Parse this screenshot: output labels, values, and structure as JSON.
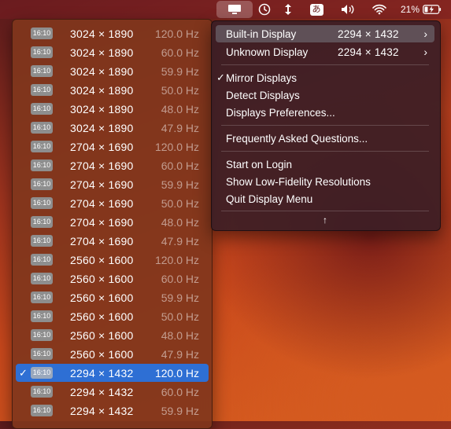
{
  "menubar": {
    "battery_percent": "21%",
    "input_source": "あ",
    "icons": [
      "display-menu-icon",
      "screen-time-icon",
      "resize-arrows-icon",
      "input-source-icon",
      "volume-icon",
      "wifi-icon",
      "battery-charging-icon"
    ]
  },
  "resolutions": [
    {
      "aspect": "16:10",
      "resolution": "3024 × 1890",
      "refresh": "120.0 Hz",
      "selected": false
    },
    {
      "aspect": "16:10",
      "resolution": "3024 × 1890",
      "refresh": "60.0 Hz",
      "selected": false
    },
    {
      "aspect": "16:10",
      "resolution": "3024 × 1890",
      "refresh": "59.9 Hz",
      "selected": false
    },
    {
      "aspect": "16:10",
      "resolution": "3024 × 1890",
      "refresh": "50.0 Hz",
      "selected": false
    },
    {
      "aspect": "16:10",
      "resolution": "3024 × 1890",
      "refresh": "48.0 Hz",
      "selected": false
    },
    {
      "aspect": "16:10",
      "resolution": "3024 × 1890",
      "refresh": "47.9 Hz",
      "selected": false
    },
    {
      "aspect": "16:10",
      "resolution": "2704 × 1690",
      "refresh": "120.0 Hz",
      "selected": false
    },
    {
      "aspect": "16:10",
      "resolution": "2704 × 1690",
      "refresh": "60.0 Hz",
      "selected": false
    },
    {
      "aspect": "16:10",
      "resolution": "2704 × 1690",
      "refresh": "59.9 Hz",
      "selected": false
    },
    {
      "aspect": "16:10",
      "resolution": "2704 × 1690",
      "refresh": "50.0 Hz",
      "selected": false
    },
    {
      "aspect": "16:10",
      "resolution": "2704 × 1690",
      "refresh": "48.0 Hz",
      "selected": false
    },
    {
      "aspect": "16:10",
      "resolution": "2704 × 1690",
      "refresh": "47.9 Hz",
      "selected": false
    },
    {
      "aspect": "16:10",
      "resolution": "2560 × 1600",
      "refresh": "120.0 Hz",
      "selected": false
    },
    {
      "aspect": "16:10",
      "resolution": "2560 × 1600",
      "refresh": "60.0 Hz",
      "selected": false
    },
    {
      "aspect": "16:10",
      "resolution": "2560 × 1600",
      "refresh": "59.9 Hz",
      "selected": false
    },
    {
      "aspect": "16:10",
      "resolution": "2560 × 1600",
      "refresh": "50.0 Hz",
      "selected": false
    },
    {
      "aspect": "16:10",
      "resolution": "2560 × 1600",
      "refresh": "48.0 Hz",
      "selected": false
    },
    {
      "aspect": "16:10",
      "resolution": "2560 × 1600",
      "refresh": "47.9 Hz",
      "selected": false
    },
    {
      "aspect": "16:10",
      "resolution": "2294 × 1432",
      "refresh": "120.0 Hz",
      "selected": true
    },
    {
      "aspect": "16:10",
      "resolution": "2294 × 1432",
      "refresh": "60.0 Hz",
      "selected": false
    },
    {
      "aspect": "16:10",
      "resolution": "2294 × 1432",
      "refresh": "59.9 Hz",
      "selected": false
    }
  ],
  "menu": {
    "displays": [
      {
        "label": "Built-in Display",
        "resolution": "2294 × 1432",
        "highlighted": true
      },
      {
        "label": "Unknown Display",
        "resolution": "2294 × 1432",
        "highlighted": false
      }
    ],
    "mirror_displays": "Mirror Displays",
    "mirror_checked": true,
    "detect_displays": "Detect Displays",
    "displays_preferences": "Displays Preferences...",
    "faq": "Frequently Asked Questions...",
    "start_on_login": "Start on Login",
    "show_low_fidelity": "Show Low-Fidelity Resolutions",
    "quit": "Quit Display Menu",
    "more_arrow": "↑"
  }
}
